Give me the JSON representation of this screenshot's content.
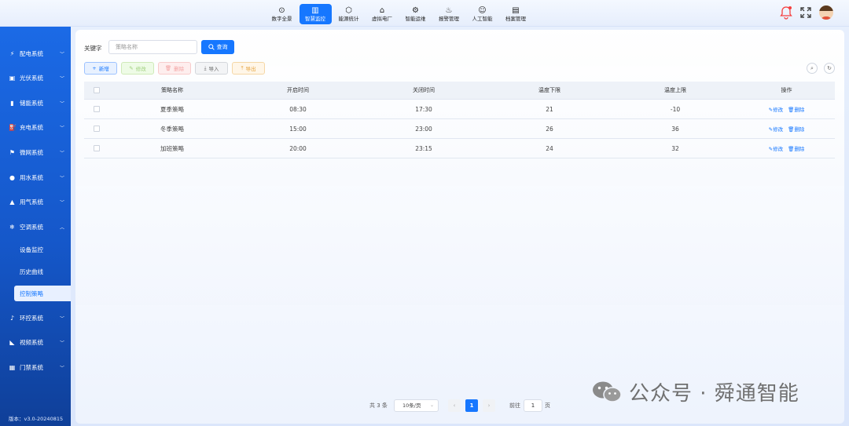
{
  "topnav": {
    "items": [
      {
        "label": "数字全景",
        "icon": "⊙",
        "active": false
      },
      {
        "label": "智慧监控",
        "icon": "▥",
        "active": true
      },
      {
        "label": "能源统计",
        "icon": "⬡",
        "active": false
      },
      {
        "label": "虚拟电厂",
        "icon": "⌂",
        "active": false
      },
      {
        "label": "智能运维",
        "icon": "⚙",
        "active": false
      },
      {
        "label": "报警管理",
        "icon": "♨",
        "active": false
      },
      {
        "label": "人工智能",
        "icon": "☺",
        "active": false
      },
      {
        "label": "档案管理",
        "icon": "▤",
        "active": false
      }
    ]
  },
  "sidebar": {
    "items": [
      {
        "label": "配电系统",
        "icon": "⚡"
      },
      {
        "label": "光伏系统",
        "icon": "▣"
      },
      {
        "label": "储能系统",
        "icon": "▮"
      },
      {
        "label": "充电系统",
        "icon": "⛽"
      },
      {
        "label": "微网系统",
        "icon": "⚑"
      },
      {
        "label": "用水系统",
        "icon": "●"
      },
      {
        "label": "用气系统",
        "icon": "▲"
      },
      {
        "label": "空调系统",
        "icon": "❄"
      }
    ],
    "sub_items": [
      {
        "label": "设备监控"
      },
      {
        "label": "历史曲线"
      },
      {
        "label": "控制策略"
      }
    ],
    "items_after": [
      {
        "label": "环控系统",
        "icon": "♪"
      },
      {
        "label": "视频系统",
        "icon": "◣"
      },
      {
        "label": "门禁系统",
        "icon": "▦"
      }
    ],
    "version": "版本：v3.0-20240815"
  },
  "search": {
    "label": "关键字",
    "placeholder": "策略名称",
    "query_label": "查询"
  },
  "toolbar": {
    "add": "新增",
    "edit": "修改",
    "delete": "删除",
    "import": "导入",
    "export": "导出"
  },
  "table": {
    "columns": [
      "策略名称",
      "开启时间",
      "关闭时间",
      "温度下限",
      "温度上限",
      "操作"
    ],
    "rows": [
      {
        "name": "夏季策略",
        "start": "08:30",
        "end": "17:30",
        "low": "21",
        "high": "-10"
      },
      {
        "name": "冬季策略",
        "start": "15:00",
        "end": "23:00",
        "low": "26",
        "high": "36"
      },
      {
        "name": "加班策略",
        "start": "20:00",
        "end": "23:15",
        "low": "24",
        "high": "32"
      }
    ],
    "op_edit": "修改",
    "op_delete": "删除"
  },
  "pager": {
    "total": "共 3 条",
    "page_size": "10条/页",
    "current": "1",
    "goto": "前往",
    "goto_value": "1",
    "unit": "页"
  },
  "watermark": {
    "text": "公众号 · 舜通智能"
  }
}
